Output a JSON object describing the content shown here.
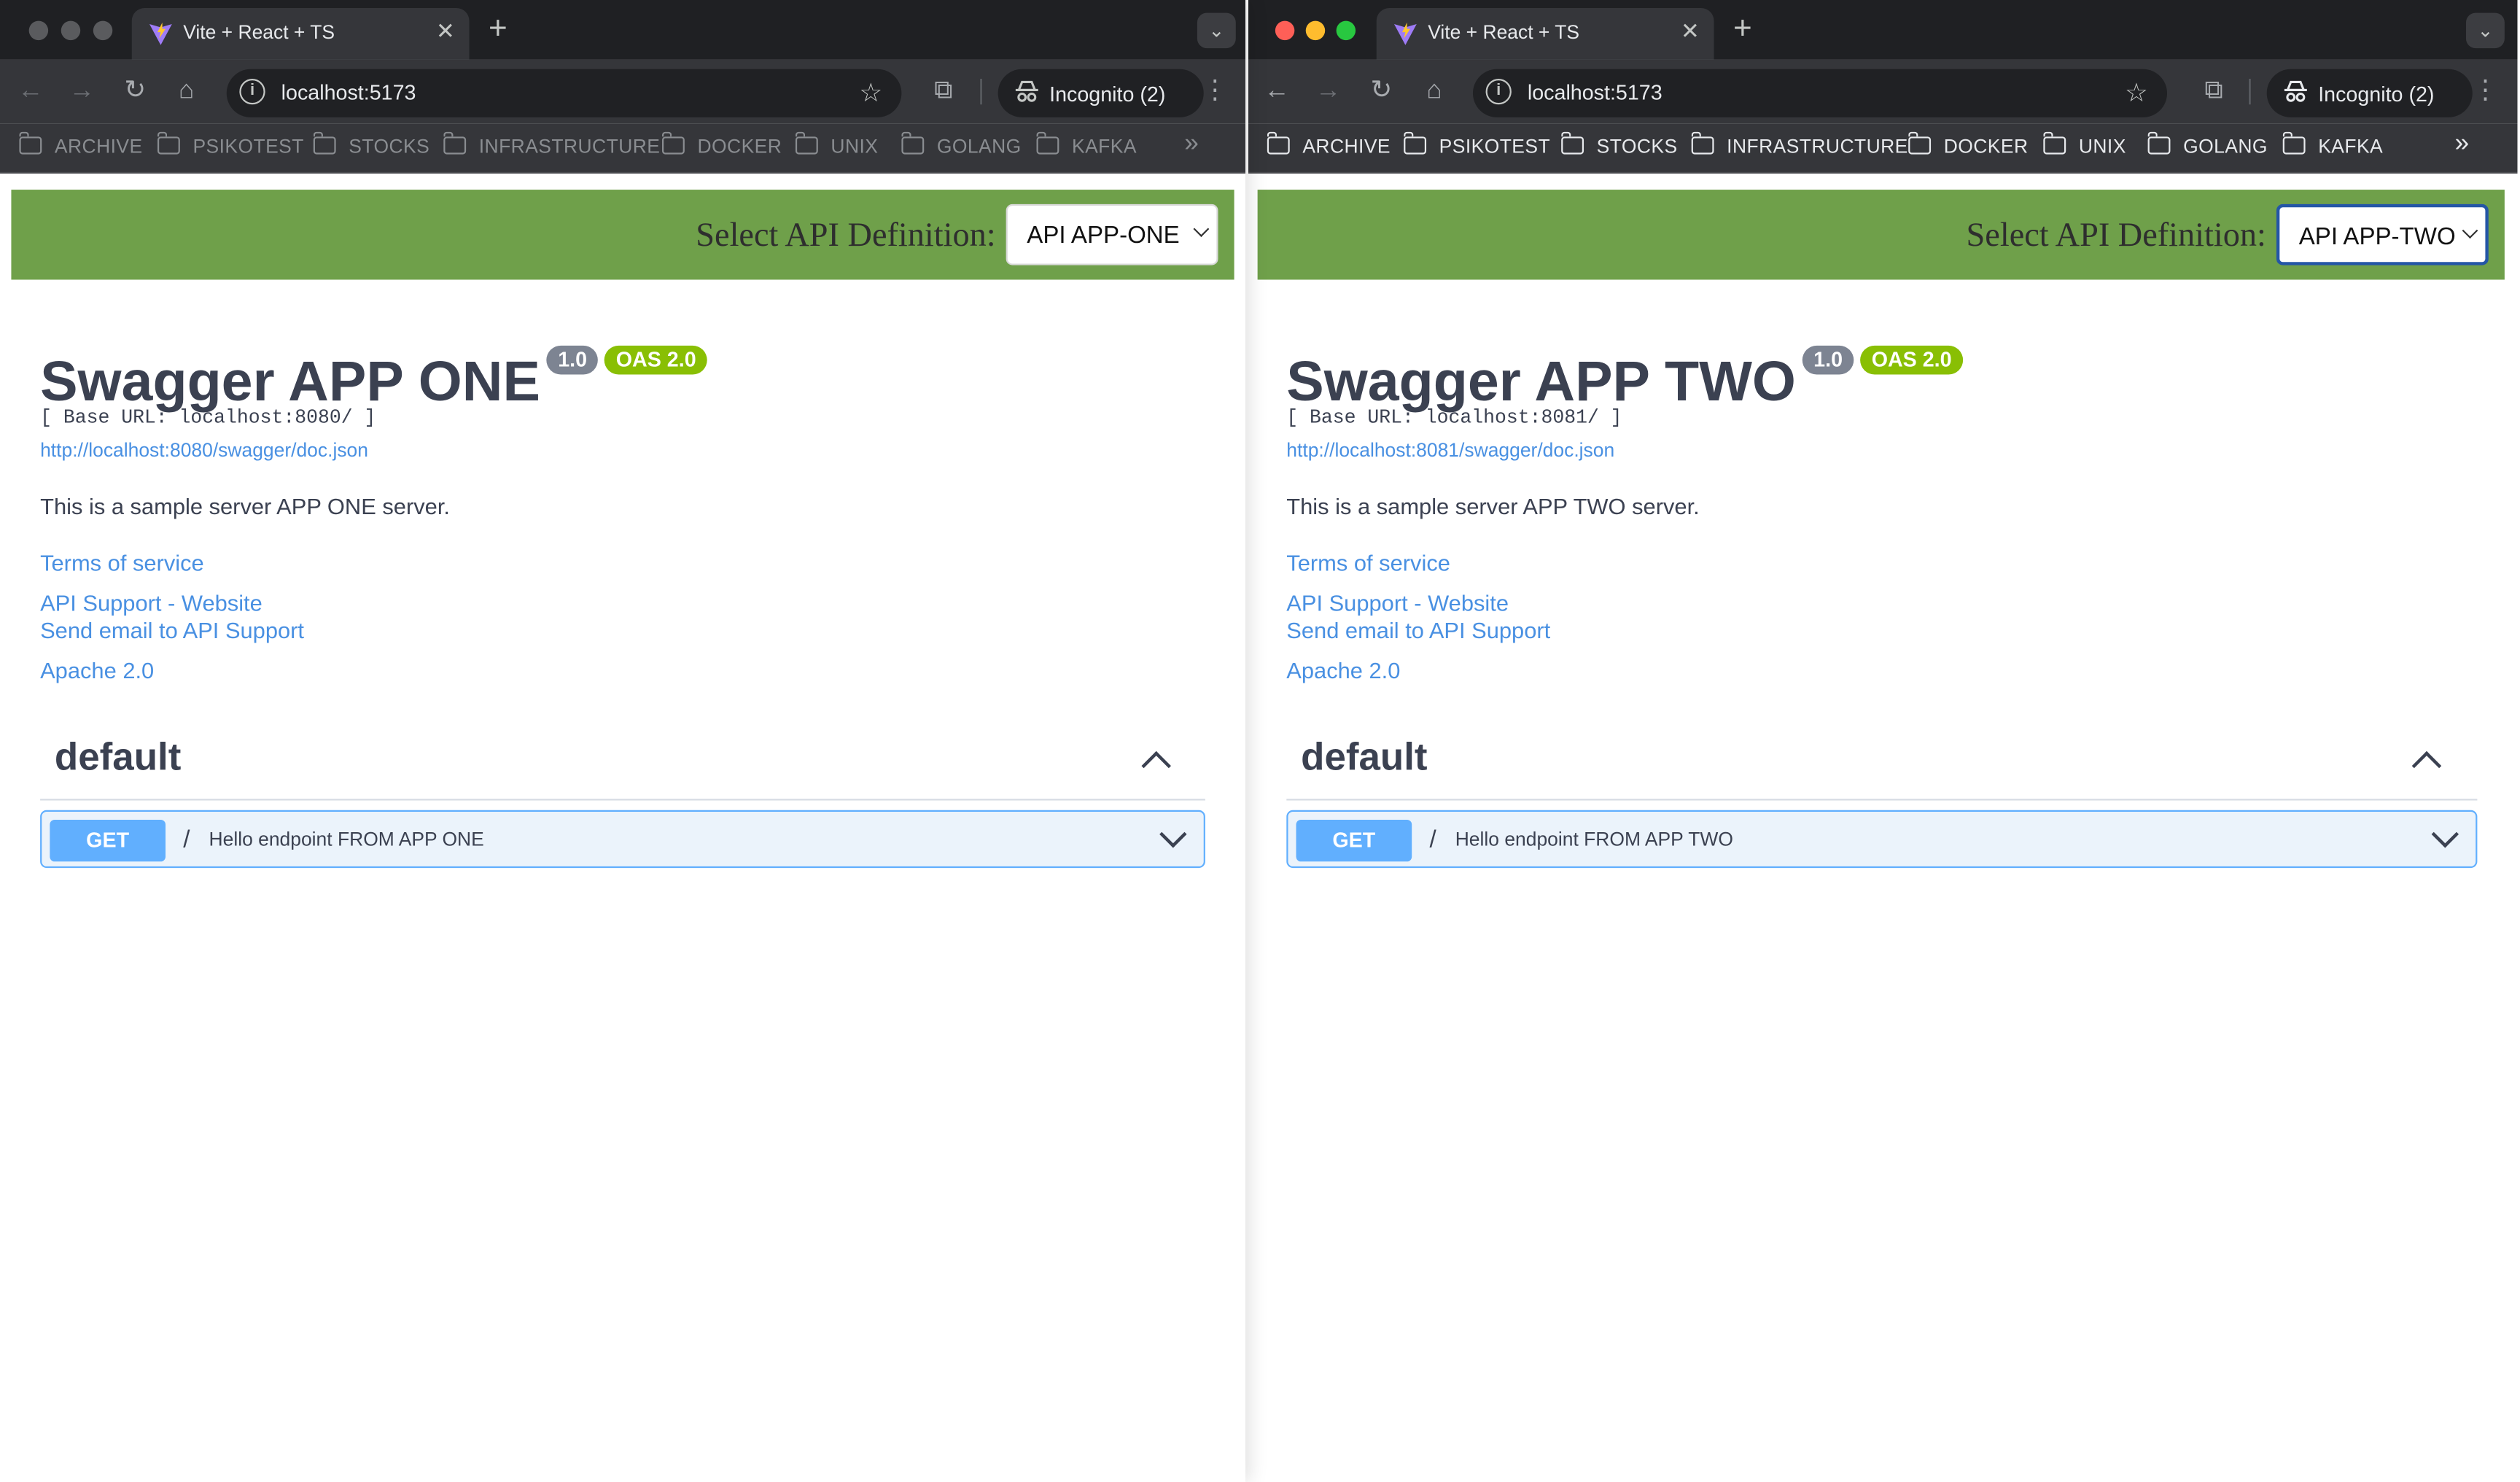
{
  "windows": [
    {
      "tab": {
        "title": "Vite + React + TS"
      },
      "omnibox": {
        "url": "localhost:5173"
      },
      "incognito": {
        "label": "Incognito (2)"
      },
      "bookmarks": [
        "ARCHIVE",
        "PSIKOTEST",
        "STOCKS",
        "INFRASTRUCTURE",
        "DOCKER",
        "UNIX",
        "GOLANG",
        "KAFKA"
      ],
      "bookmarks_more": "»",
      "topbar": {
        "label": "Select API Definition:",
        "selected": "API APP-ONE"
      },
      "info": {
        "title": "Swagger APP ONE",
        "version": "1.0",
        "oas": "OAS 2.0",
        "base_url": "[ Base URL: localhost:8080/ ]",
        "doc_url": "http://localhost:8080/swagger/doc.json",
        "description": "This is a sample server APP ONE server.",
        "terms": "Terms of service",
        "support_site": "API Support - Website",
        "support_email": "Send email to API Support",
        "license": "Apache 2.0"
      },
      "section": {
        "title": "default"
      },
      "operation": {
        "method": "GET",
        "path": "/",
        "summary": "Hello endpoint FROM APP ONE"
      }
    },
    {
      "tab": {
        "title": "Vite + React + TS"
      },
      "omnibox": {
        "url": "localhost:5173"
      },
      "incognito": {
        "label": "Incognito (2)"
      },
      "bookmarks": [
        "ARCHIVE",
        "PSIKOTEST",
        "STOCKS",
        "INFRASTRUCTURE",
        "DOCKER",
        "UNIX",
        "GOLANG",
        "KAFKA"
      ],
      "bookmarks_more": "»",
      "topbar": {
        "label": "Select API Definition:",
        "selected": "API APP-TWO"
      },
      "info": {
        "title": "Swagger APP TWO",
        "version": "1.0",
        "oas": "OAS 2.0",
        "base_url": "[ Base URL: localhost:8081/ ]",
        "doc_url": "http://localhost:8081/swagger/doc.json",
        "description": "This is a sample server APP TWO server.",
        "terms": "Terms of service",
        "support_site": "API Support - Website",
        "support_email": "Send email to API Support",
        "license": "Apache 2.0"
      },
      "section": {
        "title": "default"
      },
      "operation": {
        "method": "GET",
        "path": "/",
        "summary": "Hello endpoint FROM APP TWO"
      }
    }
  ],
  "colors": {
    "swagger_topbar": "#6fa04a",
    "get_method": "#61affe",
    "link": "#4990e2",
    "traffic_red": "#ff5f57",
    "traffic_yellow": "#febc2e",
    "traffic_green": "#28c840",
    "traffic_inactive": "#5a5b5e"
  },
  "icons": [
    "back-arrow-icon",
    "forward-arrow-icon",
    "reload-icon",
    "home-icon",
    "site-info-icon",
    "bookmark-star-icon",
    "extensions-icon",
    "incognito-icon",
    "kebab-menu-icon",
    "folder-icon",
    "vite-favicon-icon",
    "close-icon",
    "plus-icon",
    "chevron-down-icon",
    "chevron-up-icon"
  ]
}
